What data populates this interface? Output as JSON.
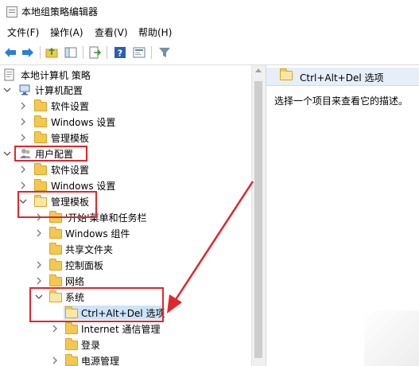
{
  "window": {
    "title": "本地组策略编辑器",
    "icon": "gpedit-app-icon"
  },
  "menu": {
    "items": [
      "文件(F)",
      "操作(A)",
      "查看(V)",
      "帮助(H)"
    ]
  },
  "toolbar": {
    "buttons": [
      "back-arrow-icon",
      "forward-arrow-icon",
      "up-folder-icon",
      "show-hide-tree-icon",
      "export-list-icon",
      "help-icon",
      "properties-icon",
      "filter-icon"
    ]
  },
  "tree": {
    "root": "本地计算机 策略",
    "computer_config": "计算机配置",
    "cc_software": "软件设置",
    "cc_windows": "Windows 设置",
    "cc_admin": "管理模板",
    "user_config": "用户配置",
    "uc_software": "软件设置",
    "uc_windows": "Windows 设置",
    "uc_admin": "管理模板",
    "start_menu": "'开始'菜单和任务栏",
    "windows_components": "Windows 组件",
    "shared_folders": "共享文件夹",
    "control_panel": "控制面板",
    "network": "网络",
    "system": "系统",
    "ctrl_alt_del": "Ctrl+Alt+Del 选项",
    "internet_comm": "Internet 通信管理",
    "logon": "登录",
    "power": "电源管理"
  },
  "detail": {
    "title": "Ctrl+Alt+Del 选项",
    "description": "选择一个项目来查看它的描述。"
  },
  "annotation": {
    "color": "#e0272d"
  }
}
